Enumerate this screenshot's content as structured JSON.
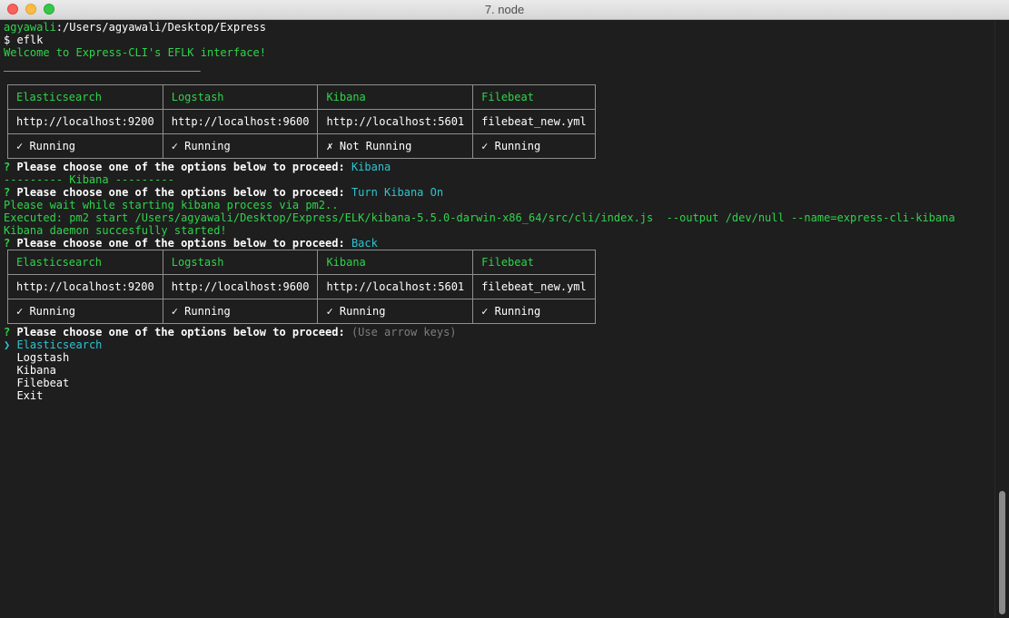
{
  "window": {
    "title": "7. node"
  },
  "terminal": {
    "prompt_user": "agyawali",
    "prompt_path": ":/Users/agyawali/Desktop/Express",
    "command_line": "$ eflk",
    "welcome": "Welcome to Express-CLI's EFLK interface!",
    "underline": "______________________________",
    "question_mark": "?",
    "question_text": "Please choose one of the options below to proceed:",
    "first_choice": "Kibana",
    "kibana_header": "--------- Kibana ---------",
    "second_choice": "Turn Kibana On",
    "wait_message": "Please wait while starting kibana process via pm2..",
    "executed_message": "Executed: pm2 start /Users/agyawali/Desktop/Express/ELK/kibana-5.5.0-darwin-x86_64/src/cli/index.js  --output /dev/null --name=express-cli-kibana",
    "daemon_message": "Kibana daemon succesfully started!",
    "third_choice": "Back",
    "hint": "(Use arrow keys)",
    "pointer": "❯"
  },
  "tables": [
    {
      "headers": [
        "Elasticsearch",
        "Logstash",
        "Kibana",
        "Filebeat"
      ],
      "urls": [
        "http://localhost:9200",
        "http://localhost:9600",
        "http://localhost:5601",
        "filebeat_new.yml"
      ],
      "statuses": [
        "✓ Running",
        "✓ Running",
        "✗ Not Running",
        "✓ Running"
      ]
    },
    {
      "headers": [
        "Elasticsearch",
        "Logstash",
        "Kibana",
        "Filebeat"
      ],
      "urls": [
        "http://localhost:9200",
        "http://localhost:9600",
        "http://localhost:5601",
        "filebeat_new.yml"
      ],
      "statuses": [
        "✓ Running",
        "✓ Running",
        "✓ Running",
        "✓ Running"
      ]
    }
  ],
  "menu": {
    "items": [
      "Elasticsearch",
      "Logstash",
      "Kibana",
      "Filebeat",
      "Exit"
    ],
    "selected": "Elasticsearch"
  },
  "colors": {
    "background": "#1e1e1e",
    "green": "#2fd34b",
    "cyan": "#2ec4d1",
    "gray": "#7d7d7d"
  }
}
